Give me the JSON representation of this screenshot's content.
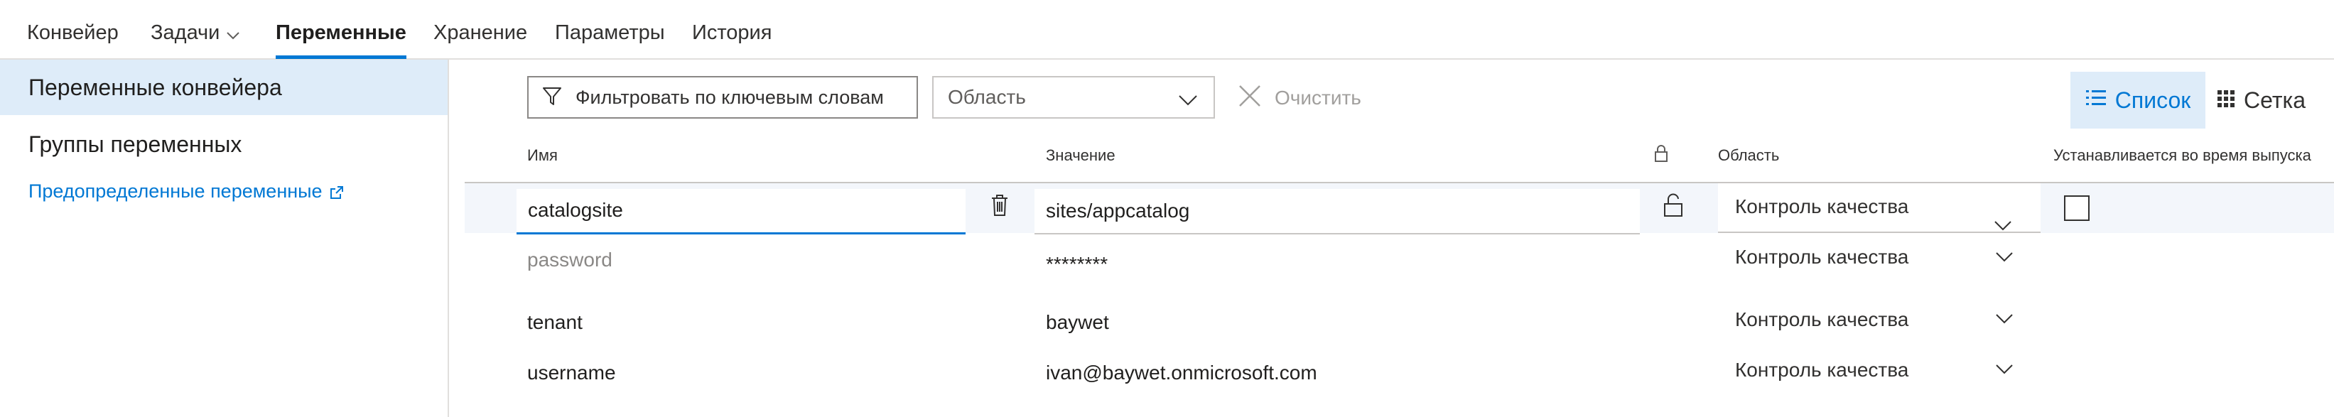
{
  "nav": {
    "tabs": [
      {
        "label": "Конвейер"
      },
      {
        "label": "Задачи"
      },
      {
        "label": "Переменные"
      },
      {
        "label": "Хранение"
      },
      {
        "label": "Параметры"
      },
      {
        "label": "История"
      }
    ],
    "active_tab": "Переменные"
  },
  "sidebar": {
    "items": [
      {
        "label": "Переменные конвейера",
        "selected": true
      },
      {
        "label": "Группы переменных",
        "selected": false
      }
    ],
    "link": {
      "label": "Предопределенные переменные",
      "icon": "external-link-icon"
    }
  },
  "toolbar": {
    "filter_placeholder": "Фильтровать по ключевым словам",
    "area_placeholder": "Область",
    "clear_label": "Очистить",
    "view_list_label": "Список",
    "view_grid_label": "Сетка",
    "accent_color": "#0078d4"
  },
  "table": {
    "headers": {
      "name": "Имя",
      "value": "Значение",
      "secret_icon": "lock-icon",
      "scope": "Область",
      "settable": "Устанавливается во время выпуска"
    },
    "rows": [
      {
        "name": "catalogsite",
        "value": "sites/appcatalog",
        "scope": "Контроль качества",
        "selected": true,
        "secret": false,
        "settable": false
      },
      {
        "name": "password",
        "value": "********",
        "scope": "Контроль качества",
        "selected": false,
        "secret": true
      },
      {
        "name": "tenant",
        "value": "baywet",
        "scope": "Контроль качества",
        "selected": false
      },
      {
        "name": "username",
        "value": "ivan@baywet.onmicrosoft.com",
        "scope": "Контроль качества",
        "selected": false
      }
    ]
  }
}
